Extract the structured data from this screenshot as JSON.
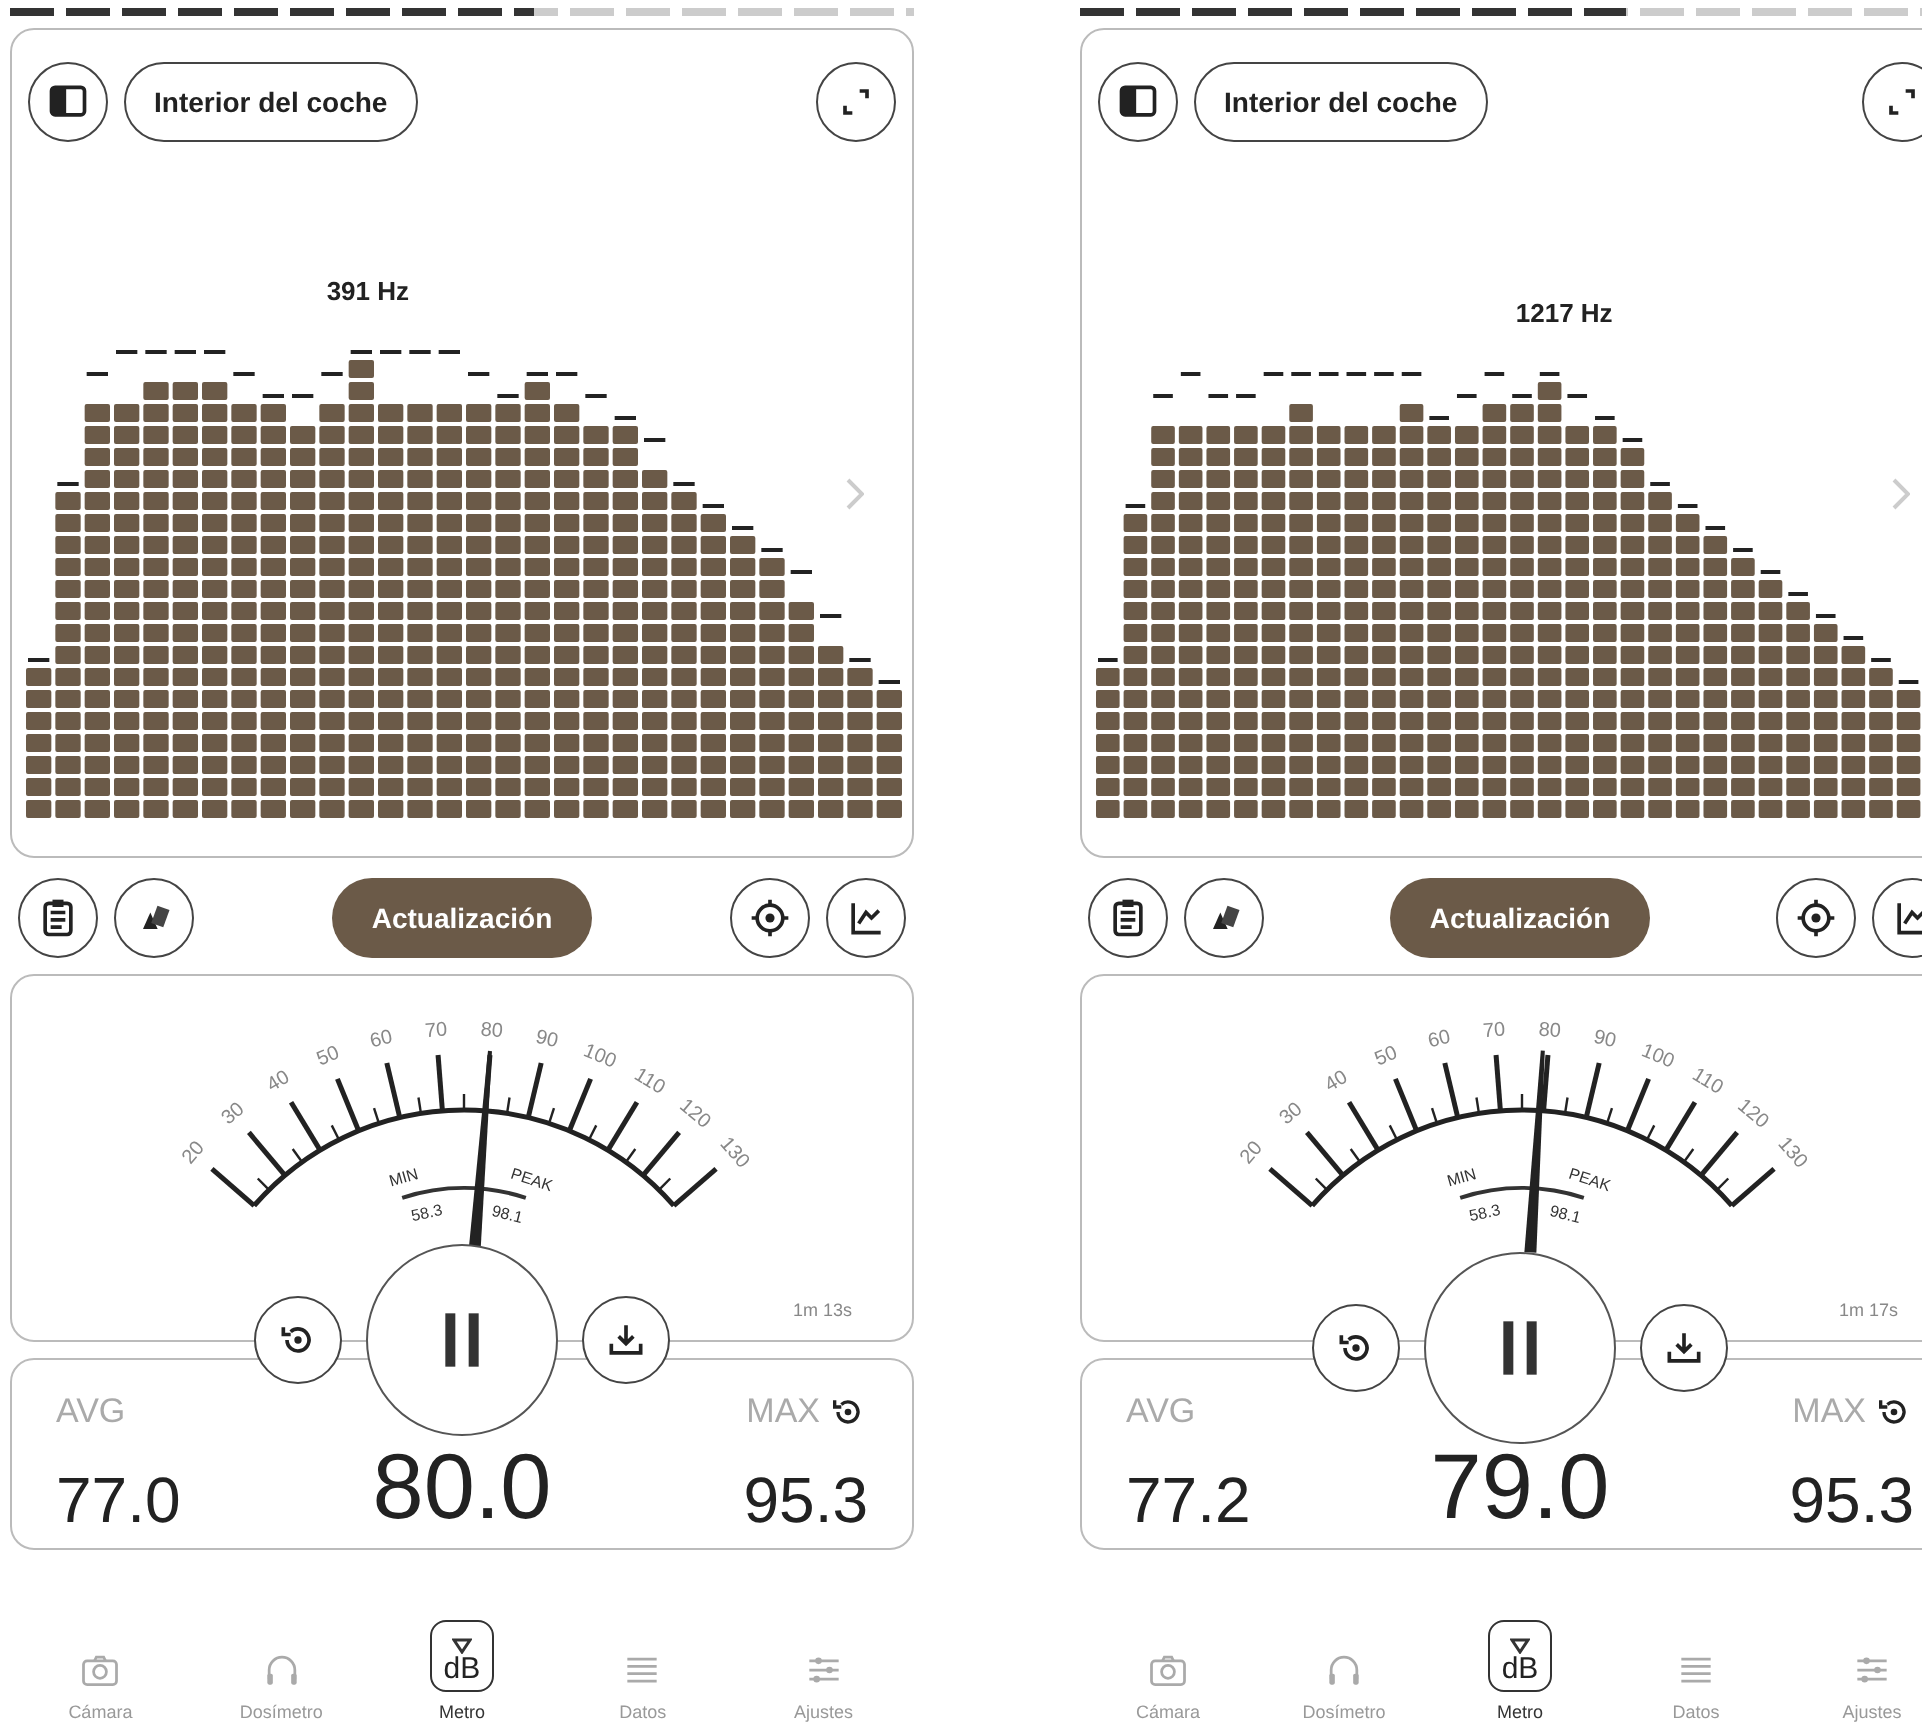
{
  "screens": [
    {
      "progress": {
        "level": 0.58
      },
      "preset": "Interior del coche",
      "peak_frequency": "391 Hz",
      "update_button": "Actualización",
      "gauge": {
        "scale": [
          "20",
          "30",
          "40",
          "50",
          "60",
          "70",
          "80",
          "90",
          "100",
          "110",
          "120",
          "130"
        ],
        "level": 0.545,
        "min_label": "MIN",
        "min_value": "58.3",
        "peak_label": "PEAK",
        "peak_value": "98.1",
        "timer": "1m 13s"
      },
      "stats": {
        "avg_label": "AVG",
        "avg": "77.0",
        "current": "80.0",
        "max_label": "MAX",
        "max": "95.3"
      },
      "nav": [
        {
          "label": "Cámara",
          "selected": false
        },
        {
          "label": "Dosímetro",
          "selected": false
        },
        {
          "label": "Metro",
          "selected": true,
          "badge": "dB"
        },
        {
          "label": "Datos",
          "selected": false
        },
        {
          "label": "Ajustes",
          "selected": false
        }
      ]
    },
    {
      "progress": {
        "level": 0.62
      },
      "preset": "Interior del coche",
      "peak_frequency": "1217 Hz",
      "update_button": "Actualización",
      "gauge": {
        "scale": [
          "20",
          "30",
          "40",
          "50",
          "60",
          "70",
          "80",
          "90",
          "100",
          "110",
          "120",
          "130"
        ],
        "level": 0.536,
        "min_label": "MIN",
        "min_value": "58.3",
        "peak_label": "PEAK",
        "peak_value": "98.1",
        "timer": "1m 17s"
      },
      "stats": {
        "avg_label": "AVG",
        "avg": "77.2",
        "current": "79.0",
        "max_label": "MAX",
        "max": "95.3"
      },
      "nav": [
        {
          "label": "Cámara",
          "selected": false
        },
        {
          "label": "Dosímetro",
          "selected": false
        },
        {
          "label": "Metro",
          "selected": true,
          "badge": "dB"
        },
        {
          "label": "Datos",
          "selected": false
        },
        {
          "label": "Ajustes",
          "selected": false
        }
      ]
    }
  ]
}
